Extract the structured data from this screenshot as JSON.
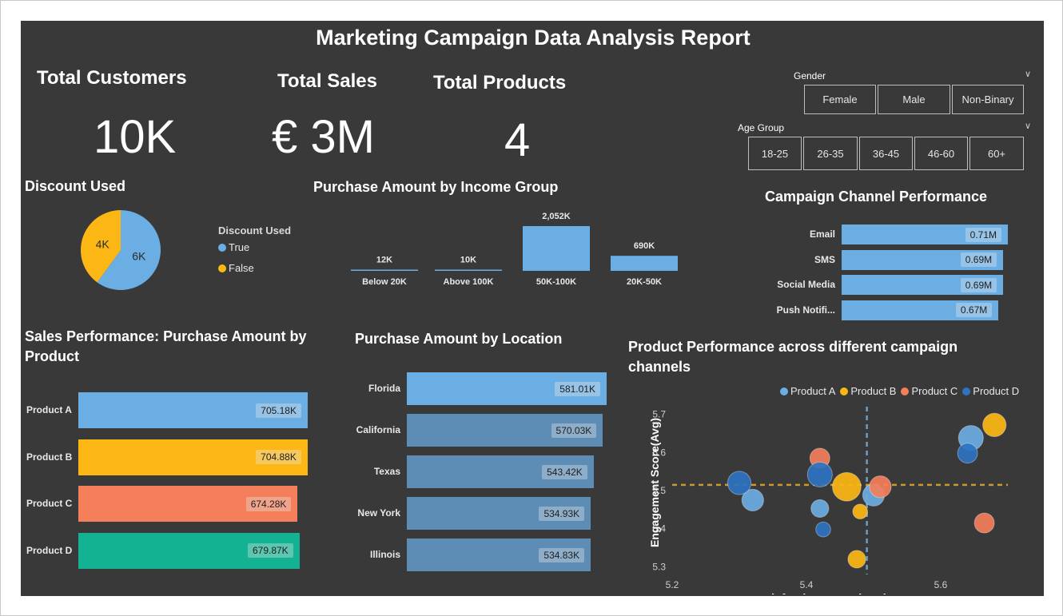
{
  "report": {
    "title": "Marketing Campaign Data Analysis Report"
  },
  "kpis": [
    {
      "label": "Total Customers",
      "value": "10K"
    },
    {
      "label": "Total Sales",
      "value": "€ 3M"
    },
    {
      "label": "Total Products",
      "value": "4"
    }
  ],
  "slicers": {
    "gender": {
      "title": "Gender",
      "options": [
        "Female",
        "Male",
        "Non-Binary"
      ]
    },
    "age_group": {
      "title": "Age Group",
      "options": [
        "18-25",
        "26-35",
        "36-45",
        "46-60",
        "60+"
      ]
    }
  },
  "icons": {
    "chevron": "chevron-down-icon"
  },
  "colors": {
    "background": "#393939",
    "blue": "#6BAEE3",
    "yellow": "#FCB715",
    "orange": "#F47F5A",
    "teal": "#12B293",
    "darkblue": "#2E73C1",
    "location_bar": "#5D8DB5"
  },
  "chart_data": [
    {
      "id": "discount",
      "type": "pie",
      "title": "Discount Used",
      "legend_title": "Discount Used",
      "legend_position": "right",
      "slices": [
        {
          "name": "True",
          "value": 6000,
          "label": "6K",
          "color": "#6BAEE3"
        },
        {
          "name": "False",
          "value": 4000,
          "label": "4K",
          "color": "#FCB715"
        }
      ]
    },
    {
      "id": "income",
      "type": "bar",
      "title": "Purchase Amount by Income Group",
      "categories": [
        "Below 20K",
        "Above 100K",
        "50K-100K",
        "20K-50K"
      ],
      "values": [
        12,
        10,
        2052,
        690
      ],
      "labels": [
        "12K",
        "10K",
        "2,052K",
        "690K"
      ],
      "color": "#6BAEE3"
    },
    {
      "id": "channel",
      "type": "bar",
      "orientation": "horizontal",
      "title": "Campaign Channel Performance",
      "categories": [
        "Email",
        "SMS",
        "Social Media",
        "Push Notifi..."
      ],
      "values": [
        0.71,
        0.69,
        0.69,
        0.67
      ],
      "labels": [
        "0.71M",
        "0.69M",
        "0.69M",
        "0.67M"
      ],
      "color": "#6BAEE3"
    },
    {
      "id": "product",
      "type": "bar",
      "orientation": "horizontal",
      "title": "Sales Performance: Purchase Amount by Product",
      "categories": [
        "Product A",
        "Product B",
        "Product C",
        "Product D"
      ],
      "values": [
        705.18,
        704.88,
        674.28,
        679.87
      ],
      "labels": [
        "705.18K",
        "704.88K",
        "674.28K",
        "679.87K"
      ],
      "colors": [
        "#6BAEE3",
        "#FCB715",
        "#F47F5A",
        "#12B293"
      ]
    },
    {
      "id": "location",
      "type": "bar",
      "orientation": "horizontal",
      "title": "Purchase Amount by Location",
      "categories": [
        "Florida",
        "California",
        "Texas",
        "New York",
        "Illinois"
      ],
      "values": [
        581.01,
        570.03,
        543.42,
        534.93,
        534.83
      ],
      "labels": [
        "581.01K",
        "570.03K",
        "543.42K",
        "534.93K",
        "534.83K"
      ],
      "colors": [
        "#6BAEE3",
        "#5D8DB5",
        "#5D8DB5",
        "#5D8DB5",
        "#5D8DB5"
      ]
    },
    {
      "id": "scatter",
      "type": "scatter",
      "title": "Product Performance across different campaign channels",
      "xlabel": "Satisfaction Score(Avg)",
      "ylabel": "Engagement Score(Avg)",
      "xlim": [
        5.2,
        5.7
      ],
      "ylim": [
        5.28,
        5.72
      ],
      "xticks": [
        "5.2",
        "5.4",
        "5.6"
      ],
      "yticks": [
        "5.3",
        "5.4",
        "5.5",
        "5.6",
        "5.7"
      ],
      "legend_position": "top-right",
      "reference_lines": {
        "x": 5.49,
        "y": 5.515
      },
      "series": [
        {
          "name": "Product A",
          "color": "#6BAEE3",
          "points": [
            {
              "x": 5.32,
              "y": 5.475,
              "size": 4
            },
            {
              "x": 5.42,
              "y": 5.453,
              "size": 2
            },
            {
              "x": 5.5,
              "y": 5.488,
              "size": 4
            },
            {
              "x": 5.645,
              "y": 5.638,
              "size": 6
            }
          ]
        },
        {
          "name": "Product B",
          "color": "#FCB715",
          "points": [
            {
              "x": 5.46,
              "y": 5.51,
              "size": 9
            },
            {
              "x": 5.48,
              "y": 5.445,
              "size": 1
            },
            {
              "x": 5.475,
              "y": 5.32,
              "size": 2
            },
            {
              "x": 5.68,
              "y": 5.672,
              "size": 5
            }
          ]
        },
        {
          "name": "Product C",
          "color": "#F47F5A",
          "points": [
            {
              "x": 5.42,
              "y": 5.585,
              "size": 3
            },
            {
              "x": 5.51,
              "y": 5.51,
              "size": 4
            },
            {
              "x": 5.665,
              "y": 5.415,
              "size": 3
            }
          ]
        },
        {
          "name": "Product D",
          "color": "#2E73C1",
          "points": [
            {
              "x": 5.3,
              "y": 5.52,
              "size": 5
            },
            {
              "x": 5.42,
              "y": 5.542,
              "size": 6
            },
            {
              "x": 5.425,
              "y": 5.398,
              "size": 1
            },
            {
              "x": 5.64,
              "y": 5.598,
              "size": 3
            }
          ]
        }
      ]
    }
  ]
}
